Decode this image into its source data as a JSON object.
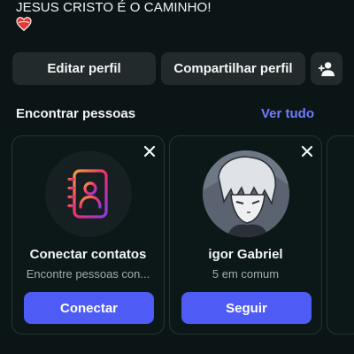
{
  "profile": {
    "bio_text": "JESUS CRISTO É O CAMINHO!",
    "bio_emoji": "heart-icon"
  },
  "actions": {
    "edit_label": "Editar perfil",
    "share_label": "Compartilhar perfil",
    "add_person_icon": "add-person-icon"
  },
  "discover": {
    "title": "Encontrar pessoas",
    "see_all_label": "Ver tudo",
    "cards": [
      {
        "name": "Conectar contatos",
        "subtitle": "Encontre pessoas con...",
        "button_label": "Conectar",
        "icon": "contacts-book-icon"
      },
      {
        "name": "igor Gabriel",
        "subtitle": "5 em comum",
        "button_label": "Seguir",
        "icon": "avatar"
      }
    ]
  },
  "colors": {
    "background": "#0b1516",
    "button_bg": "#222a2c",
    "accent": "#4e5cf5",
    "link": "#6f7dff"
  }
}
